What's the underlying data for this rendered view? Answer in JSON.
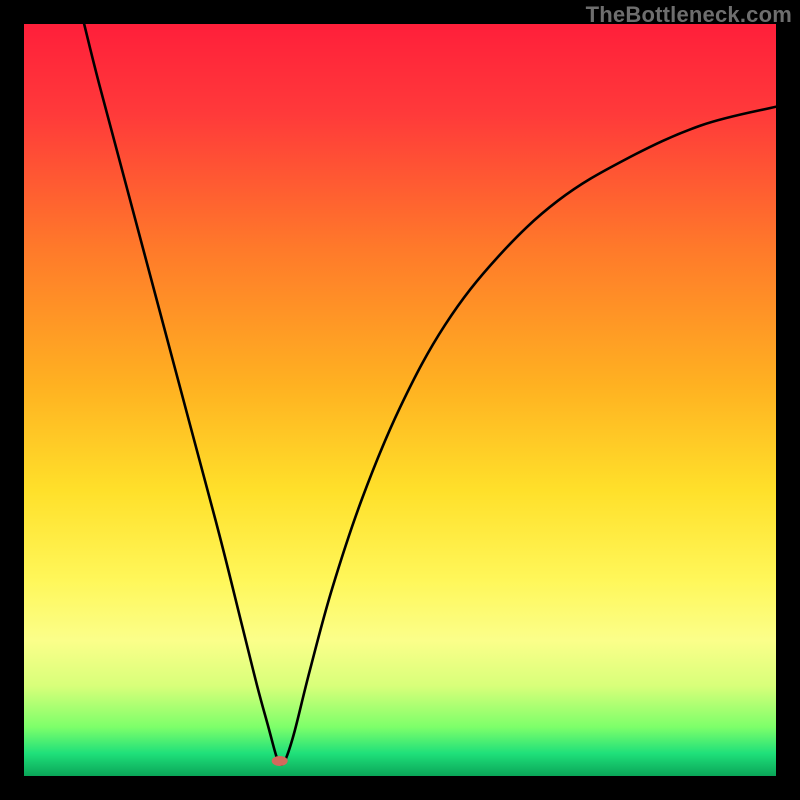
{
  "watermark": "TheBottleneck.com",
  "chart_data": {
    "type": "line",
    "title": "",
    "xlabel": "",
    "ylabel": "",
    "xlim": [
      0,
      100
    ],
    "ylim": [
      0,
      100
    ],
    "background_gradient": {
      "stops": [
        {
          "offset": 0.0,
          "color": "#ff1f3a"
        },
        {
          "offset": 0.12,
          "color": "#ff3a3a"
        },
        {
          "offset": 0.3,
          "color": "#ff7a2a"
        },
        {
          "offset": 0.48,
          "color": "#ffb121"
        },
        {
          "offset": 0.62,
          "color": "#ffe02a"
        },
        {
          "offset": 0.74,
          "color": "#fff75a"
        },
        {
          "offset": 0.82,
          "color": "#fbff8a"
        },
        {
          "offset": 0.88,
          "color": "#d8ff7a"
        },
        {
          "offset": 0.935,
          "color": "#7dff6a"
        },
        {
          "offset": 0.97,
          "color": "#1fe07a"
        },
        {
          "offset": 1.0,
          "color": "#0aa558"
        }
      ]
    },
    "marker": {
      "x": 34,
      "y": 2,
      "color": "#d26a5c",
      "rx": 8,
      "ry": 5
    },
    "series": [
      {
        "name": "curve",
        "type": "line",
        "points": [
          {
            "x": 8.0,
            "y": 100.0
          },
          {
            "x": 10.0,
            "y": 92.0
          },
          {
            "x": 14.0,
            "y": 77.0
          },
          {
            "x": 18.0,
            "y": 62.0
          },
          {
            "x": 22.0,
            "y": 47.0
          },
          {
            "x": 26.0,
            "y": 32.0
          },
          {
            "x": 29.0,
            "y": 20.0
          },
          {
            "x": 31.0,
            "y": 12.0
          },
          {
            "x": 32.5,
            "y": 6.5
          },
          {
            "x": 33.6,
            "y": 2.5
          },
          {
            "x": 34.2,
            "y": 1.5
          },
          {
            "x": 34.9,
            "y": 2.5
          },
          {
            "x": 36.0,
            "y": 6.0
          },
          {
            "x": 38.0,
            "y": 14.0
          },
          {
            "x": 41.0,
            "y": 25.0
          },
          {
            "x": 45.0,
            "y": 37.0
          },
          {
            "x": 50.0,
            "y": 49.0
          },
          {
            "x": 56.0,
            "y": 60.0
          },
          {
            "x": 63.0,
            "y": 69.0
          },
          {
            "x": 71.0,
            "y": 76.5
          },
          {
            "x": 80.0,
            "y": 82.0
          },
          {
            "x": 90.0,
            "y": 86.5
          },
          {
            "x": 100.0,
            "y": 89.0
          }
        ]
      }
    ]
  }
}
